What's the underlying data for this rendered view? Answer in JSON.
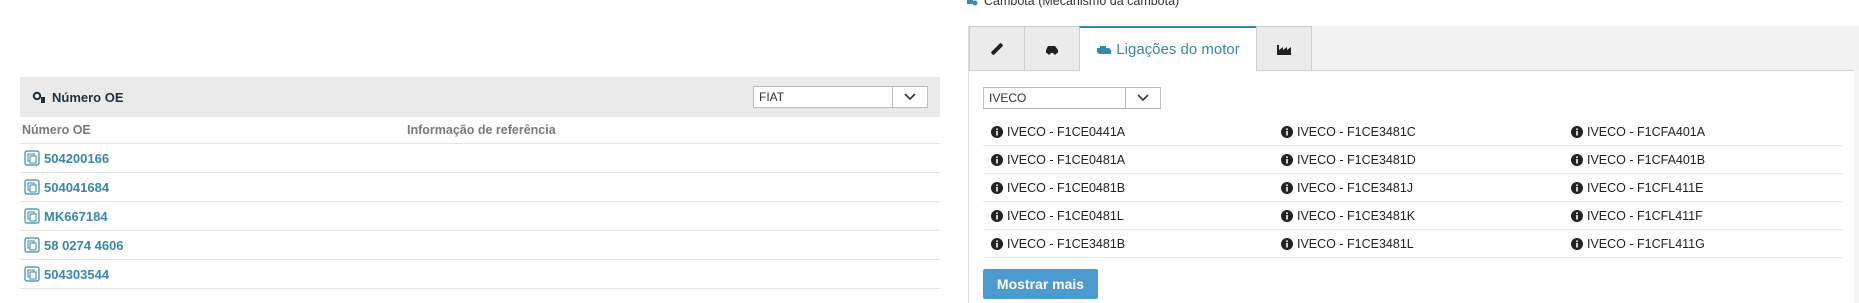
{
  "right_panel": {
    "title": "Cambota (Mecanismo da cambota)",
    "tabs": [
      {
        "icon": "ruler-icon"
      },
      {
        "icon": "car-icon"
      },
      {
        "icon": "engine-icon",
        "label": "Ligações do motor"
      },
      {
        "icon": "factory-icon"
      }
    ],
    "manufacturer_select": {
      "value": "IVECO"
    },
    "engines": [
      [
        "IVECO - F1CE0441A",
        "IVECO - F1CE3481C",
        "IVECO - F1CFA401A"
      ],
      [
        "IVECO - F1CE0481A",
        "IVECO - F1CE3481D",
        "IVECO - F1CFA401B"
      ],
      [
        "IVECO - F1CE0481B",
        "IVECO - F1CE3481J",
        "IVECO - F1CFL411E"
      ],
      [
        "IVECO - F1CE0481L",
        "IVECO - F1CE3481K",
        "IVECO - F1CFL411F"
      ],
      [
        "IVECO - F1CE3481B",
        "IVECO - F1CE3481L",
        "IVECO - F1CFL411G"
      ]
    ],
    "show_more_label": "Mostrar mais"
  },
  "oe_panel": {
    "title": "Número OE",
    "brand_select": {
      "value": "FIAT"
    },
    "columns": [
      "Número OE",
      "Informação de referência"
    ],
    "rows": [
      "504200166",
      "504041684",
      "MK667184",
      "58 0274 4606",
      "504303544"
    ]
  },
  "colors": {
    "accent": "#3a87ad",
    "button": "#4b9bd0",
    "header_bg": "#eaeaea"
  }
}
